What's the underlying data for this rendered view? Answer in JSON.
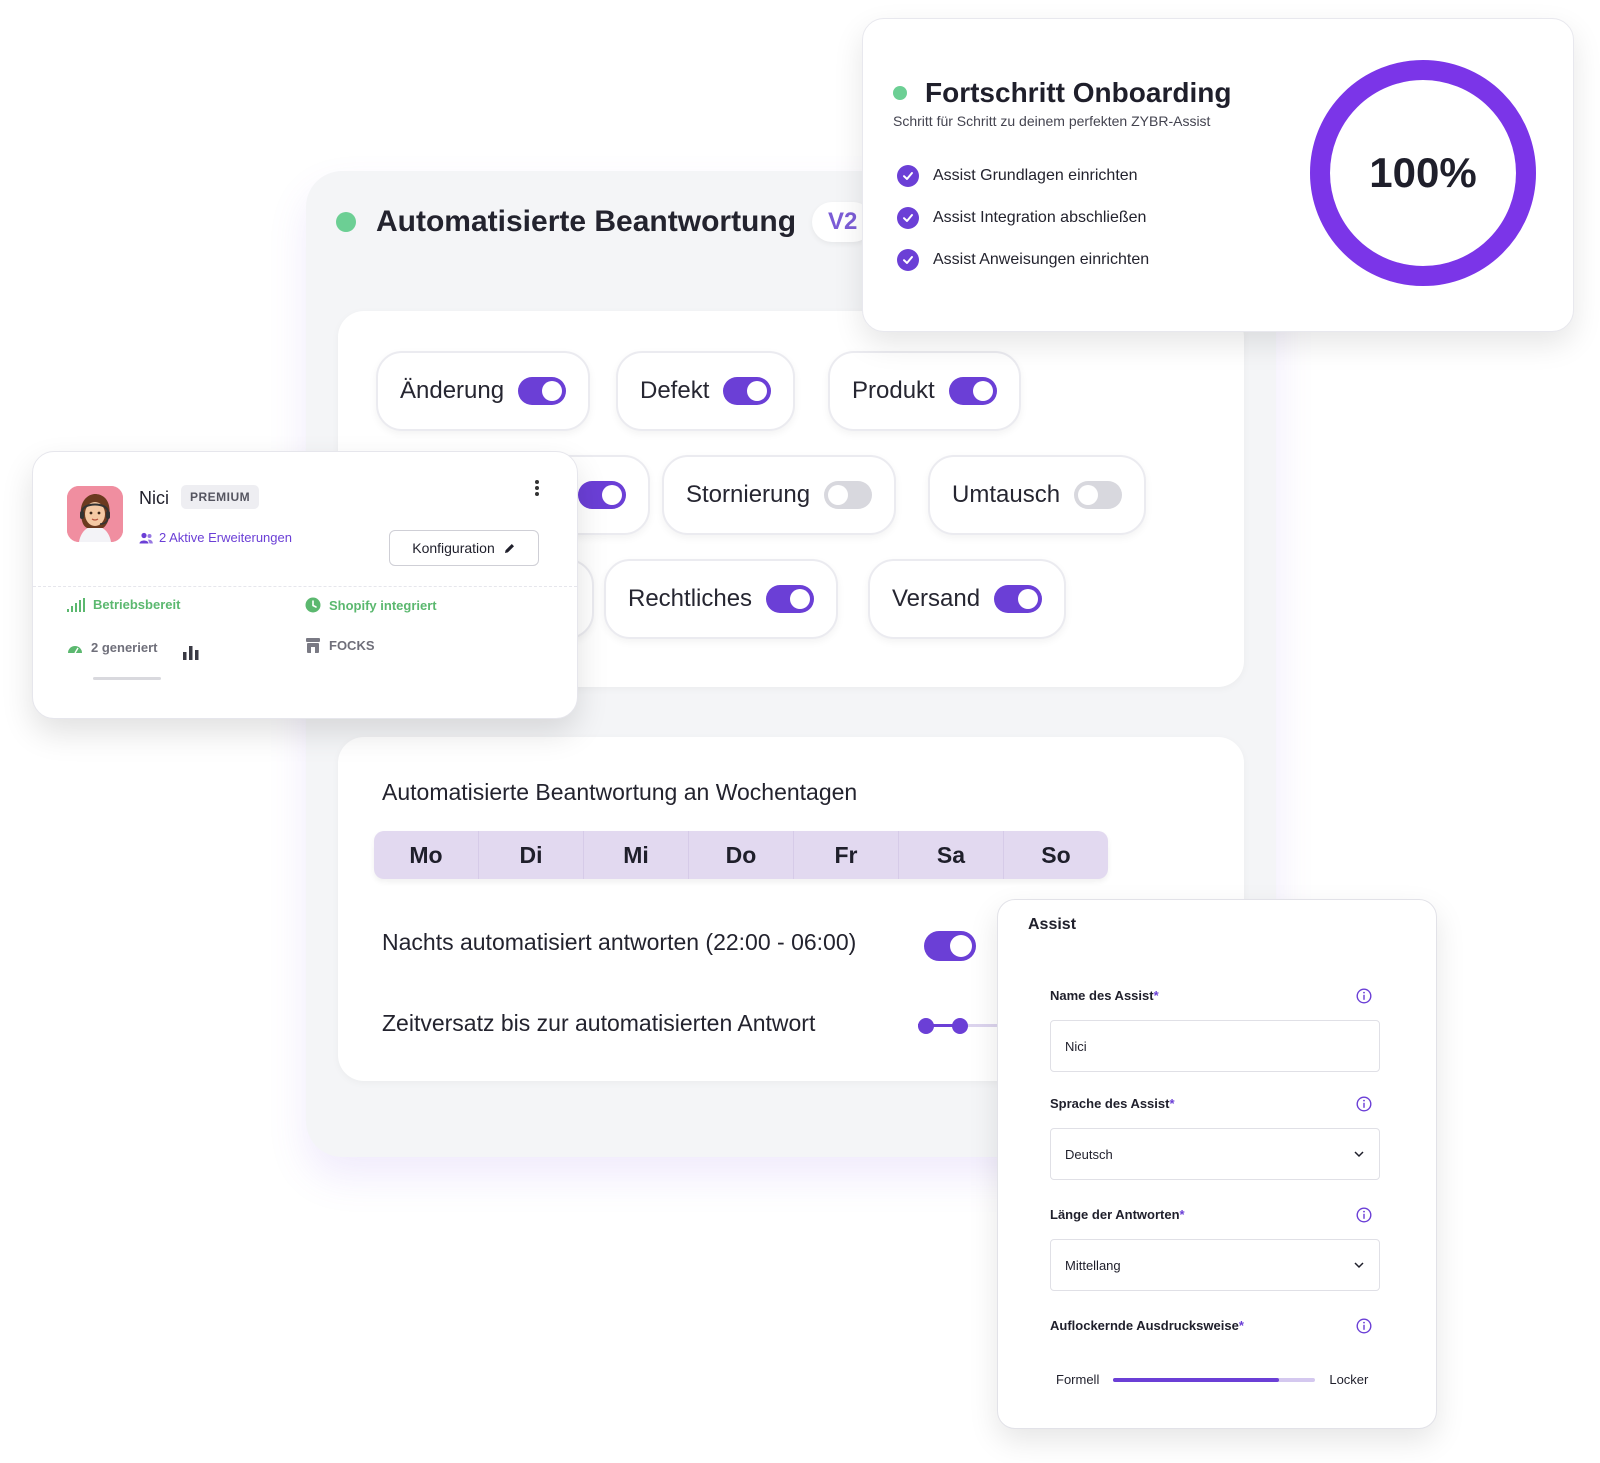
{
  "main": {
    "title": "Automatisierte Beantwortung",
    "version_badge": "V2",
    "categories": [
      {
        "label": "Änderung",
        "on": true
      },
      {
        "label": "Defekt",
        "on": true
      },
      {
        "label": "Produkt",
        "on": true
      },
      {
        "label": "",
        "on": true
      },
      {
        "label": "Stornierung",
        "on": false
      },
      {
        "label": "Umtausch",
        "on": false
      },
      {
        "label": "",
        "on": true
      },
      {
        "label": "Rechtliches",
        "on": true
      },
      {
        "label": "Versand",
        "on": true
      }
    ],
    "schedule": {
      "title": "Automatisierte Beantwortung an Wochentagen",
      "days": [
        "Mo",
        "Di",
        "Mi",
        "Do",
        "Fr",
        "Sa",
        "So"
      ],
      "night_label": "Nachts automatisiert antworten (22:00 - 06:00)",
      "night_on": true,
      "delay_label": "Zeitversatz bis zur automatisierten Antwort"
    }
  },
  "onboarding": {
    "title": "Fortschritt Onboarding",
    "subtitle": "Schritt für Schritt zu deinem perfekten ZYBR-Assist",
    "steps": [
      "Assist Grundlagen einrichten",
      "Assist Integration abschließen",
      "Assist Anweisungen einrichten"
    ],
    "progress_label": "100%",
    "progress_value": 1.0,
    "ring_color": "#7b35e8"
  },
  "profile": {
    "name": "Nici",
    "plan_badge": "PREMIUM",
    "extensions": "2 Aktive Erweiterungen",
    "config_button": "Konfiguration",
    "status_ready": "Betriebsbereit",
    "status_shopify": "Shopify integriert",
    "generated": "2 generiert",
    "shop_name": "FOCKS"
  },
  "assist_form": {
    "title": "Assist",
    "name_label": "Name des Assist",
    "name_value": "Nici",
    "language_label": "Sprache des Assist",
    "language_value": "Deutsch",
    "length_label": "Länge der Antworten",
    "length_value": "Mittellang",
    "tone_label": "Auflockernde Ausdrucksweise",
    "tone_min": "Formell",
    "tone_max": "Locker",
    "tone_value": 0.82,
    "required_mark": "*"
  },
  "colors": {
    "accent": "#6b3fd6",
    "status_green": "#6ccf94"
  }
}
